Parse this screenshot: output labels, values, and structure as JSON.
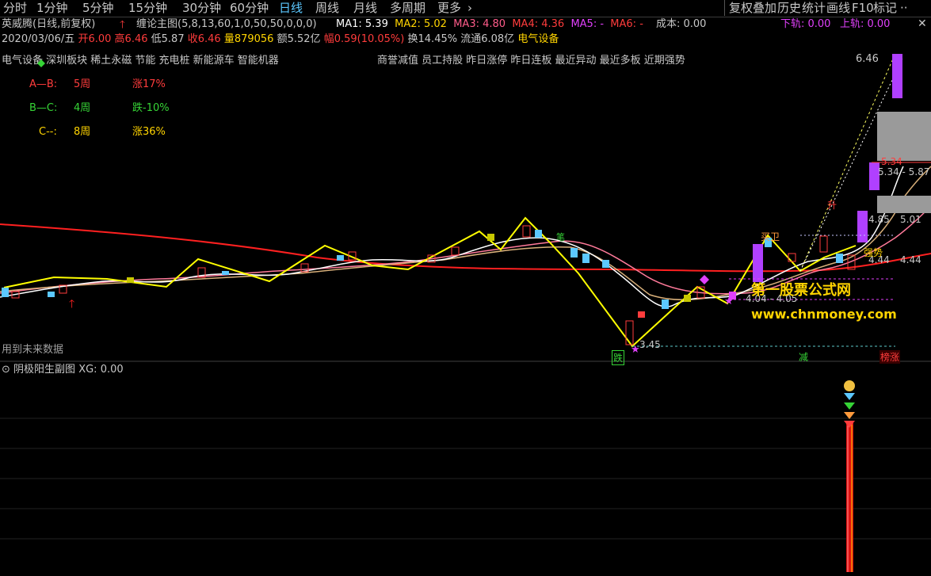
{
  "tabs": [
    "分时",
    "1分钟",
    "5分钟",
    "15分钟",
    "30分钟",
    "60分钟",
    "日线",
    "周线",
    "月线",
    "多周期",
    "更多"
  ],
  "active_tab": "日线",
  "right_tabs": [
    "复权叠加",
    "历史",
    "统计",
    "画线",
    "F10",
    "标记"
  ],
  "stock": {
    "title": "英威腾(日线,前复权)",
    "indicator": "缠论主图(5,8,13,60,1,0,50,50,0,0,0)",
    "ma": [
      {
        "label": "MA1: 5.39",
        "color": "#ffffff"
      },
      {
        "label": "MA2: 5.02",
        "color": "#ffd400"
      },
      {
        "label": "MA3: 4.80",
        "color": "#ff5c8a"
      },
      {
        "label": "MA4: 4.36",
        "color": "#ff3c3c"
      },
      {
        "label": "MA5: -",
        "color": "#e040fb"
      },
      {
        "label": "MA6: -",
        "color": "#ff3c3c"
      }
    ],
    "cost_label": "成本: 0.00",
    "rail_down": "下轨: 0.00",
    "rail_up": "上轨: 0.00"
  },
  "quote": {
    "date": "2020/03/06/五",
    "open": "开6.00",
    "high": "高6.46",
    "low": "低5.87",
    "close": "收6.46",
    "volume": "量879056",
    "amount": "额5.52亿",
    "change": "幅0.59(10.05%)",
    "turnover": "换14.45%",
    "float": "流通6.08亿",
    "sector": "电气设备"
  },
  "concepts": "电气设备 深圳板块 稀土永磁 节能 充电桩 新能源车 智能机器",
  "concepts2": "商誉减值 员工持股 昨日涨停 昨日连板 最近异动 最近多板 近期强势",
  "waves": [
    {
      "name": "A—B:",
      "period": "5周",
      "chg": "涨17%"
    },
    {
      "name": "B—C:",
      "period": "4周",
      "chg": "跌-10%"
    },
    {
      "name": "C--:",
      "period": "8周",
      "chg": "涨36%"
    }
  ],
  "chart_labels": {
    "high_price": "6.46",
    "price_534": "5.34",
    "range_534": "5.34 - 5.87",
    "price_485": "4.85",
    "range_501": "5.01",
    "price_444": "4.44",
    "range_444": "4.44",
    "range_404": "4.04 - 4.05",
    "low_price": "3.45",
    "marker_die": "跌",
    "marker_jian": "减",
    "marker_bangzhang": "榜涨",
    "marker_sheng": "升",
    "marker_mai": "买卫",
    "marker_qiangshi": "强势",
    "marker_bi": "笔",
    "future_note": "用到未来数据"
  },
  "sub_chart": {
    "title": "阴极阳生副图",
    "xg": "XG: 0.00"
  },
  "watermark": {
    "line1": "第一股票公式网",
    "line2": "www.chnmoney.com"
  }
}
